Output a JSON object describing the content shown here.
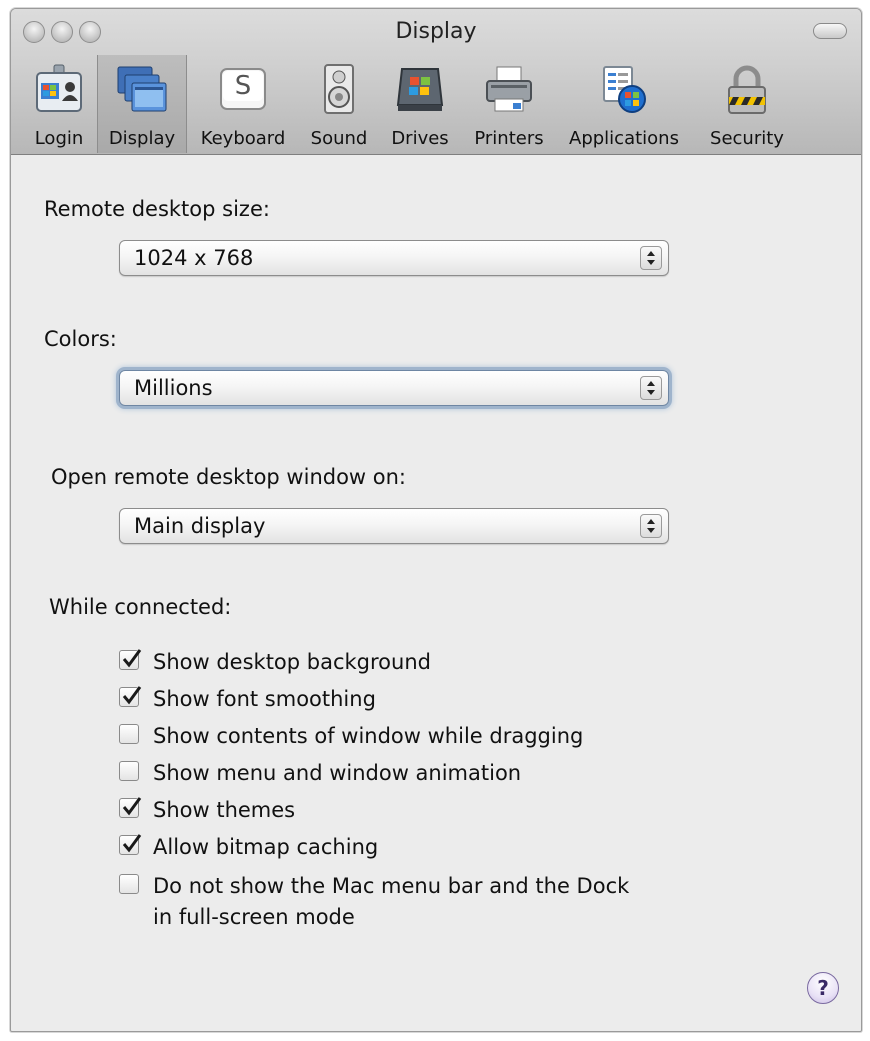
{
  "window": {
    "title": "Display"
  },
  "toolbar": {
    "items": [
      {
        "label": "Login",
        "icon": "login-icon"
      },
      {
        "label": "Display",
        "icon": "display-icon",
        "selected": true
      },
      {
        "label": "Keyboard",
        "icon": "keyboard-icon",
        "glyph": "S"
      },
      {
        "label": "Sound",
        "icon": "speaker-icon"
      },
      {
        "label": "Drives",
        "icon": "drive-icon"
      },
      {
        "label": "Printers",
        "icon": "printer-icon"
      },
      {
        "label": "Applications",
        "icon": "applications-icon"
      },
      {
        "label": "Security",
        "icon": "padlock-icon"
      }
    ]
  },
  "remote_size": {
    "label": "Remote desktop size:",
    "value": "1024 x 768"
  },
  "colors": {
    "label": "Colors:",
    "value": "Millions"
  },
  "open_on": {
    "label": "Open remote desktop window on:",
    "value": "Main display"
  },
  "while_connected": {
    "label": "While connected:",
    "options": [
      {
        "label": "Show desktop background",
        "checked": true
      },
      {
        "label": "Show font smoothing",
        "checked": true
      },
      {
        "label": "Show contents of window while dragging",
        "checked": false
      },
      {
        "label": "Show menu and window animation",
        "checked": false
      },
      {
        "label": "Show themes",
        "checked": true
      },
      {
        "label": "Allow bitmap caching",
        "checked": true
      },
      {
        "label": "Do not show the Mac menu bar and the Dock",
        "label2": "in full-screen mode",
        "checked": false
      }
    ]
  },
  "help": {
    "label": "?"
  }
}
